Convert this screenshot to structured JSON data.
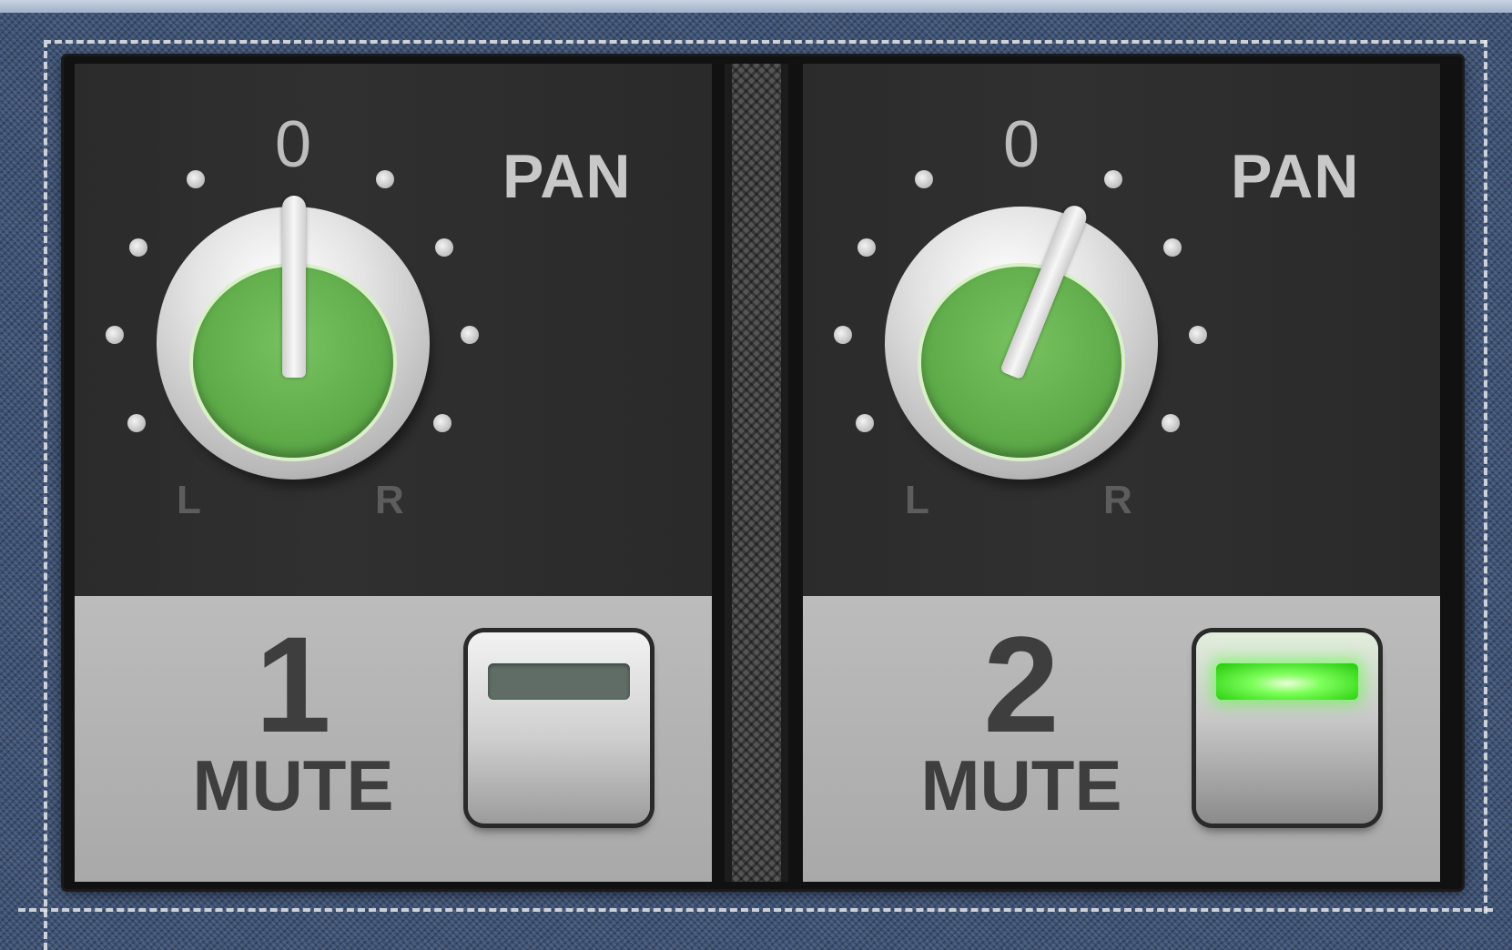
{
  "pan_label": "PAN",
  "pan_center_label": "0",
  "pan_left_label": "L",
  "pan_right_label": "R",
  "mute_label": "MUTE",
  "channels": [
    {
      "number": "1",
      "pan_value": 0,
      "mute_on": false
    },
    {
      "number": "2",
      "pan_value": 0,
      "mute_on": true
    }
  ],
  "colors": {
    "knob_cap": "#62ae4c",
    "mute_light_on": "#3cff1e",
    "mute_light_off": "#5f6d66",
    "background": "#3a4f72"
  }
}
